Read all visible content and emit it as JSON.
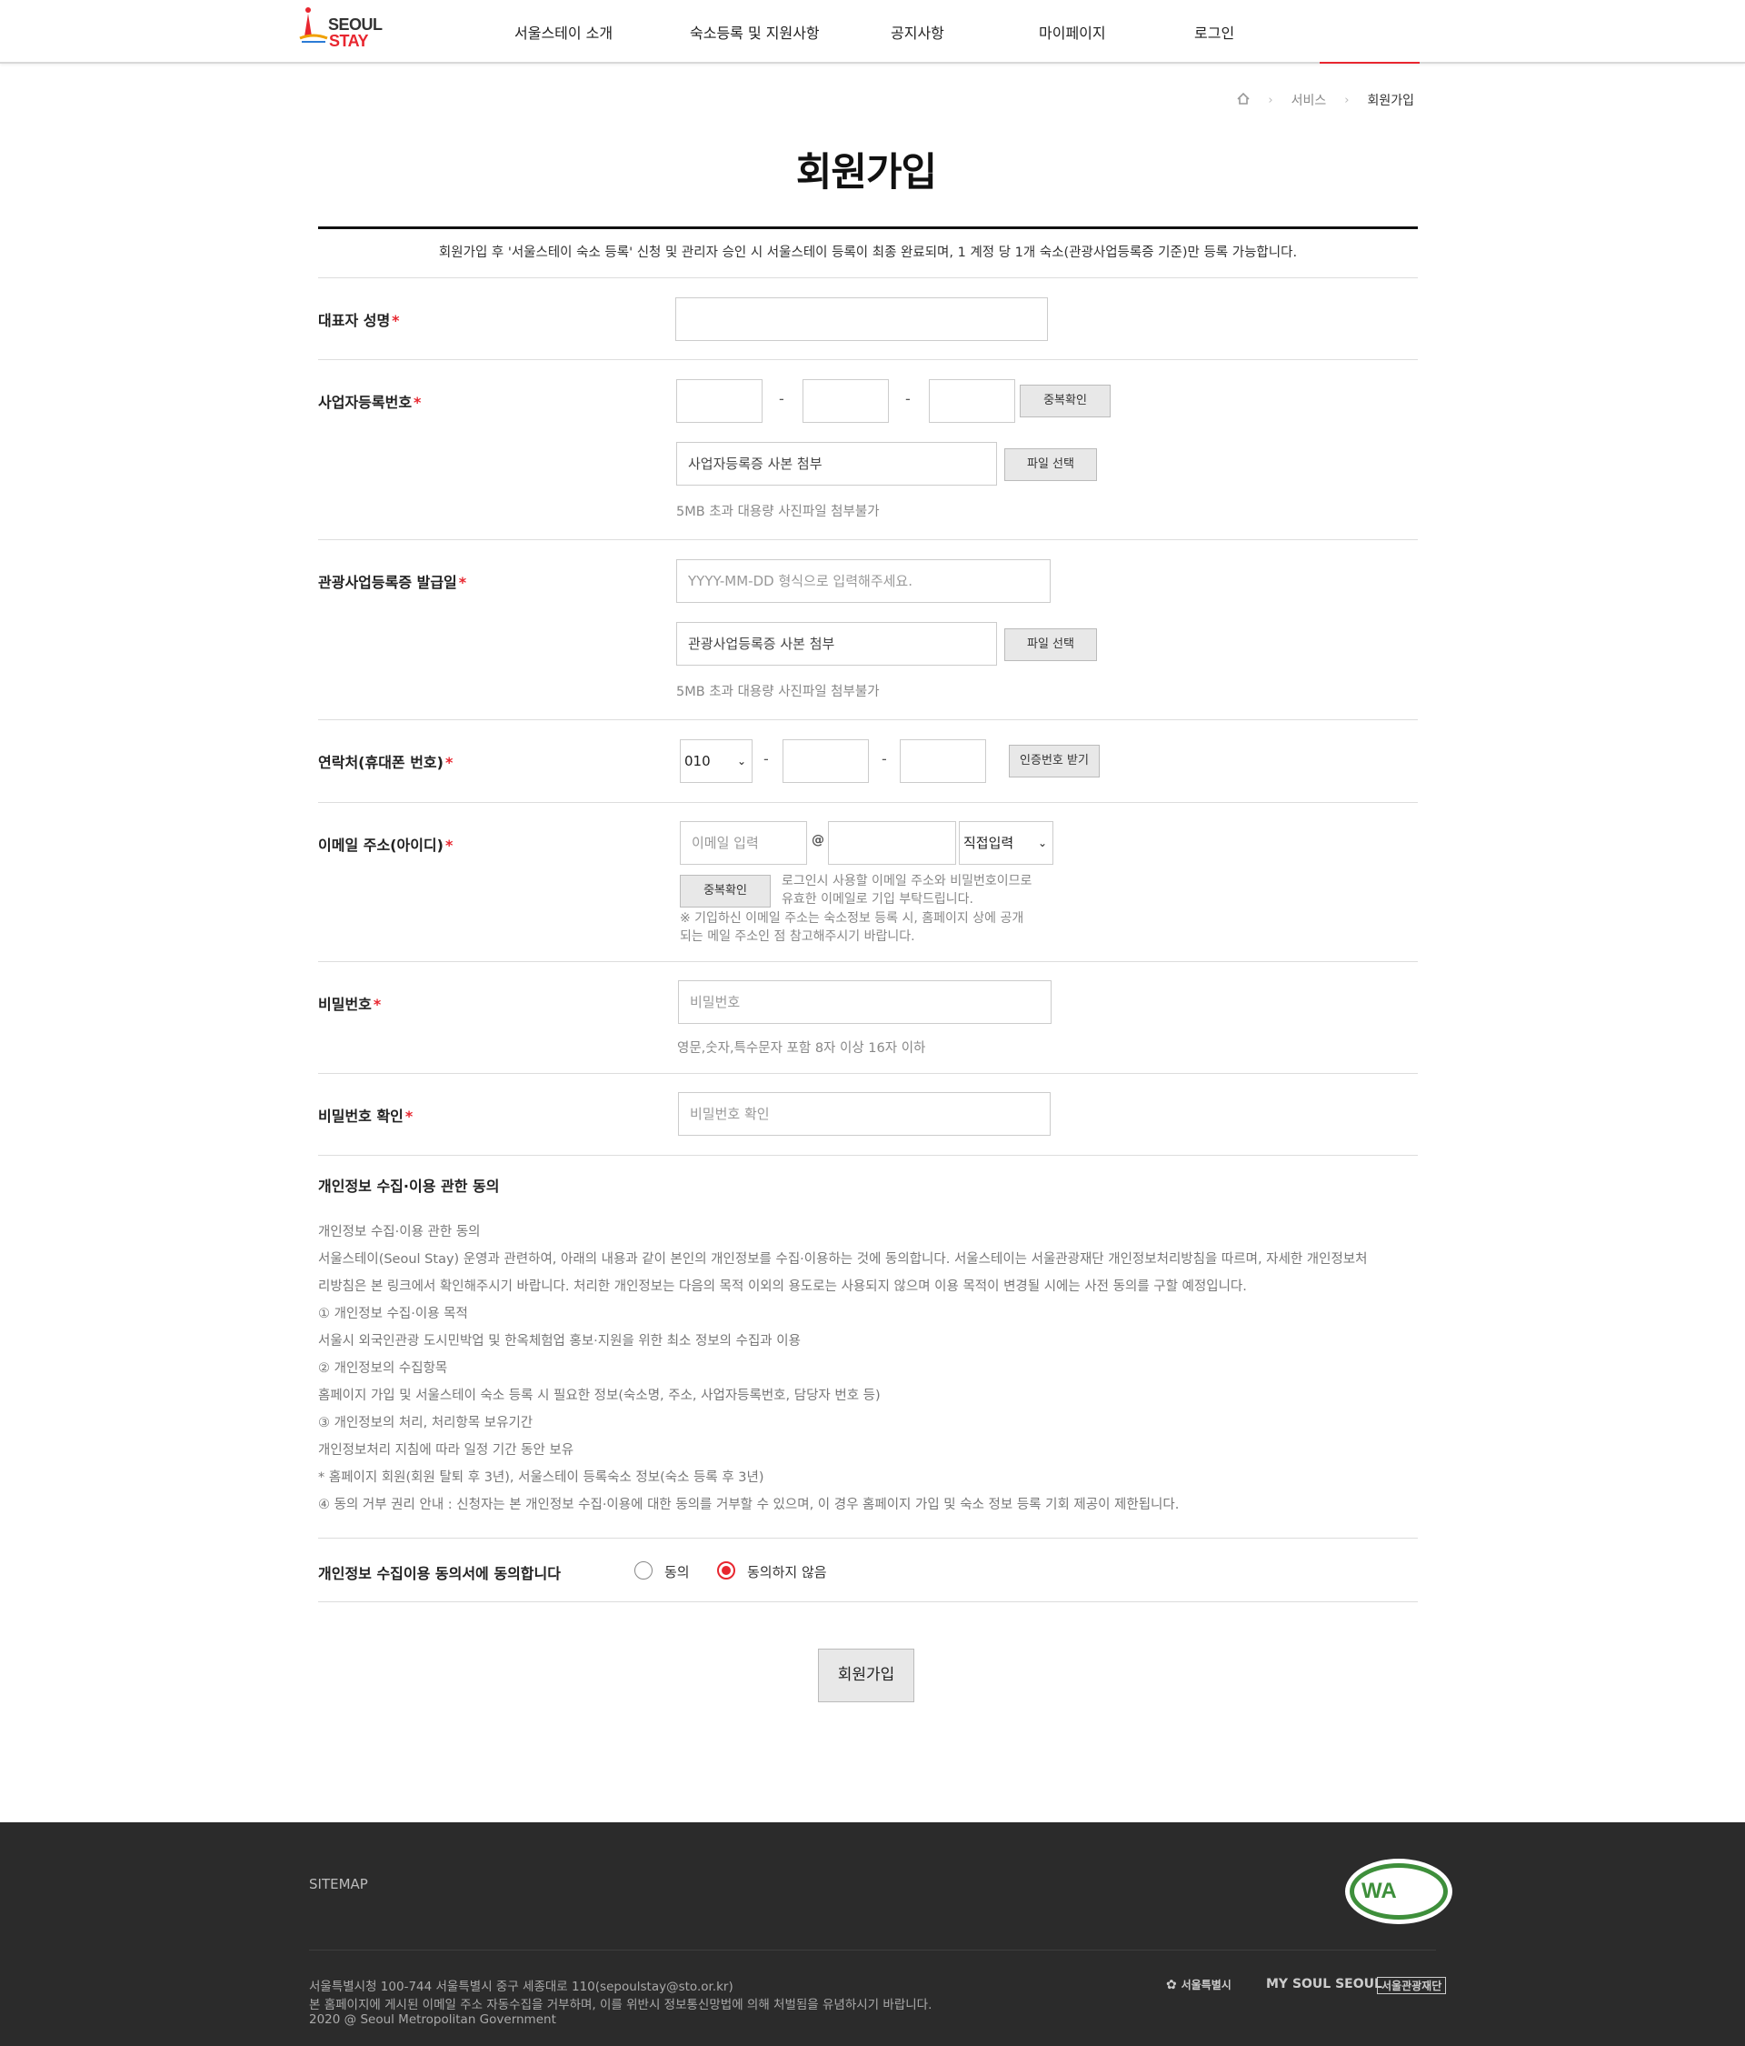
{
  "header": {
    "logo_line1": "SEOUL",
    "logo_line2": "STAY",
    "nav": [
      "서울스테이 소개",
      "숙소등록 및 지원사항",
      "공지사항",
      "마이페이지",
      "로그인"
    ]
  },
  "breadcrumb": {
    "service": "서비스",
    "current": "회원가입"
  },
  "page_title": "회원가입",
  "notice": "회원가입 후 '서울스테이 숙소 등록' 신청 및 관리자 승인 시 서울스테이 등록이 최종 완료되며, 1 계정 당 1개 숙소(관광사업등록증 기준)만 등록 가능합니다.",
  "fields": {
    "rep_name": {
      "label": "대표자 성명"
    },
    "biz_no": {
      "label": "사업자등록번호",
      "dup_btn": "중복확인",
      "file_placeholder": "사업자등록증 사본 첨부",
      "file_btn": "파일 선택",
      "hint": "5MB 초과 대용량 사진파일 첨부불가"
    },
    "tour_date": {
      "label": "관광사업등록증 발급일",
      "placeholder": "YYYY-MM-DD 형식으로 입력해주세요.",
      "file_placeholder": "관광사업등록증 사본 첨부",
      "file_btn": "파일 선택",
      "hint": "5MB 초과 대용량 사진파일 첨부불가"
    },
    "phone": {
      "label": "연락처(휴대폰 번호)",
      "prefix": "010",
      "auth_btn": "인증번호 받기"
    },
    "email": {
      "label": "이메일 주소(아이디)",
      "placeholder": "이메일 입력",
      "at": "@",
      "domain_select": "직접입력",
      "dup_btn": "중복확인",
      "note1": "로그인시 사용할 이메일 주소와 비밀번호이므로",
      "note2": "유효한 이메일로 기입 부탁드립니다.",
      "note3": "※ 기입하신 이메일 주소는 숙소정보 등록 시, 홈페이지 상에 공개",
      "note4": "되는 메일 주소인 점 참고해주시기 바랍니다."
    },
    "password": {
      "label": "비밀번호",
      "placeholder": "비밀번호",
      "hint": "영문,숫자,특수문자 포함 8자 이상 16자 이하"
    },
    "password_confirm": {
      "label": "비밀번호 확인",
      "placeholder": "비밀번호 확인"
    }
  },
  "privacy": {
    "title": "개인정보 수집·이용 관한 동의",
    "lines": [
      "개인정보 수집·이용 관한 동의",
      "서울스테이(Seoul Stay) 운영과 관련하여, 아래의 내용과 같이 본인의 개인정보를 수집·이용하는 것에 동의합니다. 서울스테이는 서울관광재단 개인정보처리방침을 따르며, 자세한 개인정보처",
      "리방침은 본 링크에서 확인해주시기 바랍니다. 처리한 개인정보는 다음의 목적 이외의 용도로는 사용되지 않으며 이용 목적이 변경될 시에는 사전 동의를 구할 예정입니다.",
      "① 개인정보 수집·이용 목적",
      "서울시 외국인관광 도시민박업 및 한옥체험업 홍보·지원을 위한 최소 정보의 수집과 이용",
      "② 개인정보의 수집항목",
      "홈페이지 가입 및 서울스테이 숙소 등록 시 필요한 정보(숙소명, 주소, 사업자등록번호, 담당자 번호 등)",
      "③ 개인정보의 처리, 처리항목 보유기간",
      "개인정보처리 지침에 따라 일정 기간 동안 보유",
      "* 홈페이지 회원(회원 탈퇴 후 3년), 서울스테이 등록숙소 정보(숙소 등록 후 3년)",
      "④ 동의 거부 권리 안내 : 신청자는 본 개인정보 수집·이용에 대한 동의를 거부할 수 있으며, 이 경우 홈페이지 가입 및 숙소 정보 등록 기회 제공이 제한됩니다."
    ],
    "consent_label": "개인정보 수집이용 동의서에 동의합니다",
    "agree": "동의",
    "disagree": "동의하지 않음",
    "selected": "disagree"
  },
  "submit": "회원가입",
  "footer": {
    "sitemap": "SITEMAP",
    "address": "서울특별시청 100-744 서울특별시 중구 세종대로 110(sepoulstay@sto.or.kr)",
    "notice": "본 홈페이지에 게시된 이메일 주소 자동수집을 거부하며, 이를 위반시 정보통신망법에 의해 처벌됨을 유념하시기 바랍니다.",
    "copyright": "2020 @ Seoul Metropolitan Government",
    "wa_mark": "WA",
    "logos": [
      "서울특별시",
      "MY SOUL SEOUL",
      "서울관광재단"
    ]
  },
  "colors": {
    "accent": "#e8262f",
    "footer_bg": "#2b2b2b",
    "wa_green": "#3e8f3b"
  }
}
